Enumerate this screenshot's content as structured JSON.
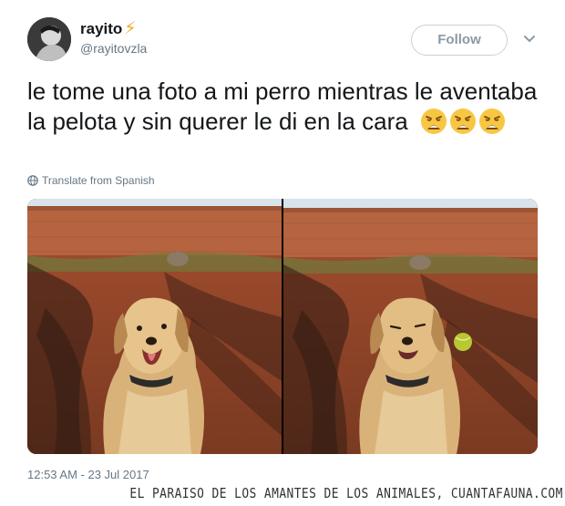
{
  "tweet": {
    "author_name": "rayito",
    "author_emoji": "⚡",
    "handle": "@rayitovzla",
    "follow_label": "Follow",
    "text": "le tome una foto a mi perro mientras le aventaba la pelota y sin querer le di en la cara",
    "text_emoji_name": "weary-face",
    "text_emoji_count": 3,
    "translate_label": "Translate from Spanish",
    "timestamp": "12:53 AM - 23 Jul 2017",
    "media": [
      {
        "description_icon": "dog-photo",
        "ball_visible": false
      },
      {
        "description_icon": "dog-photo",
        "ball_visible": true
      }
    ]
  },
  "watermark": {
    "text": "EL PARAISO DE LOS AMANTES DE LOS ANIMALES, CUANTAFAUNA.COM"
  },
  "colors": {
    "text": "#14171a",
    "secondary": "#657786",
    "follow_border": "#c8d0d6",
    "bolt": "#f5a623",
    "emoji": "#f7c744"
  }
}
